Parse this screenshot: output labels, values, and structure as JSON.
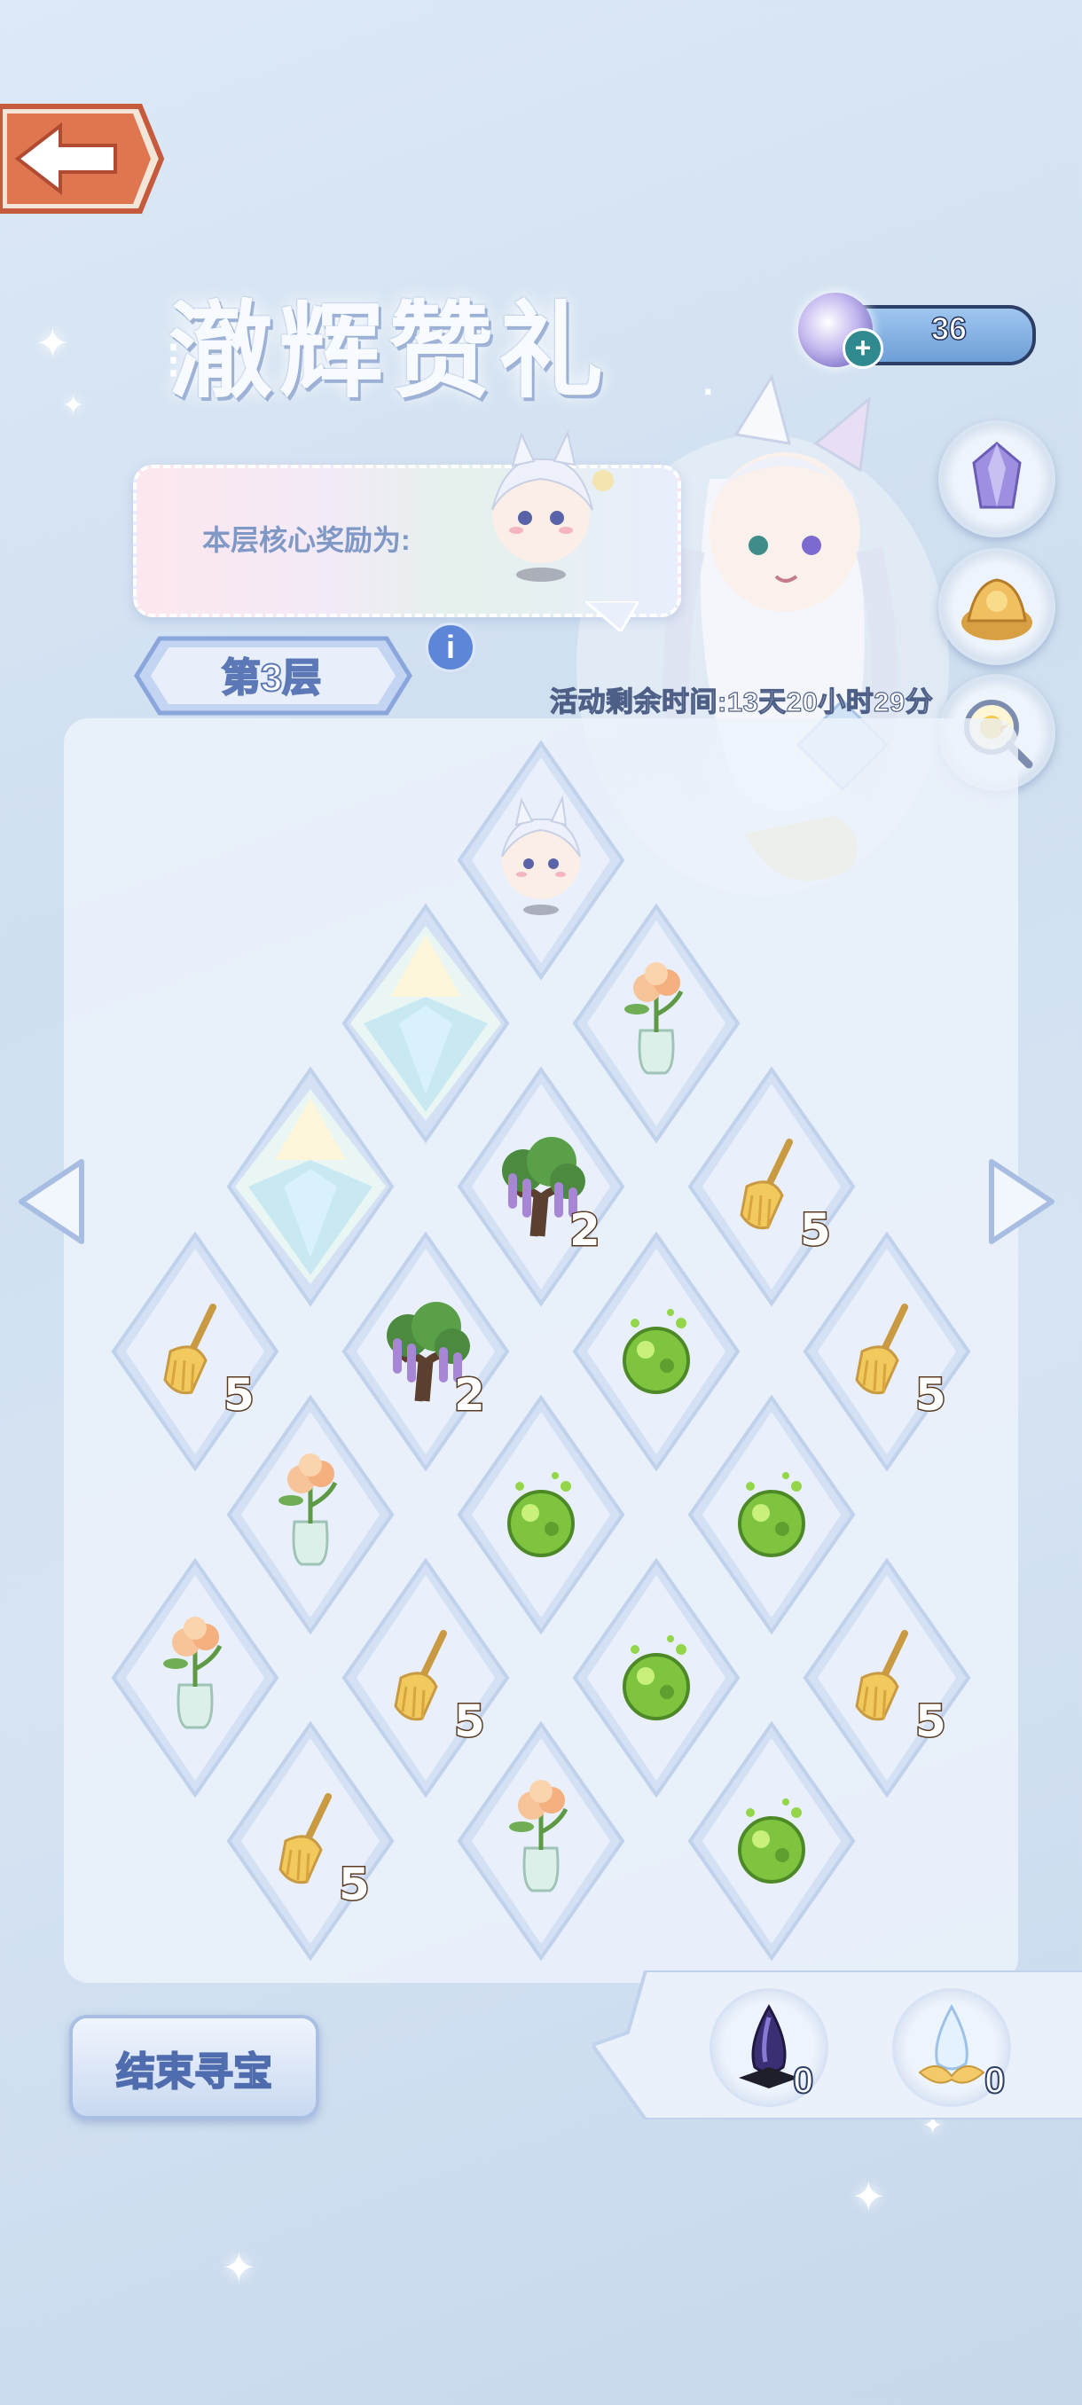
{
  "header": {
    "title": "澈辉赞礼",
    "currency": {
      "icon": "crystal-orb-icon",
      "value": "36"
    }
  },
  "reward": {
    "label": "本层核心奖励为:"
  },
  "floor": {
    "label": "第3层"
  },
  "timer": "活动剩余时间:13天20小时29分",
  "side_buttons": [
    {
      "name": "crystal-shard-icon"
    },
    {
      "name": "treasure-pile-icon"
    },
    {
      "name": "magnifier-duck-icon"
    }
  ],
  "board": {
    "tiles": [
      {
        "item": "pet",
        "count": ""
      },
      {
        "item": "crystal",
        "count": ""
      },
      {
        "item": "flower",
        "count": ""
      },
      {
        "item": "crystal",
        "count": ""
      },
      {
        "item": "tree",
        "count": "2"
      },
      {
        "item": "broom",
        "count": "5"
      },
      {
        "item": "broom",
        "count": "5"
      },
      {
        "item": "tree",
        "count": "2"
      },
      {
        "item": "orb",
        "count": ""
      },
      {
        "item": "broom",
        "count": "5"
      },
      {
        "item": "flower",
        "count": ""
      },
      {
        "item": "orb",
        "count": ""
      },
      {
        "item": "orb",
        "count": ""
      },
      {
        "item": "flower",
        "count": ""
      },
      {
        "item": "broom",
        "count": "5"
      },
      {
        "item": "orb",
        "count": ""
      },
      {
        "item": "broom",
        "count": "5"
      },
      {
        "item": "broom",
        "count": "5"
      },
      {
        "item": "flower",
        "count": ""
      },
      {
        "item": "orb",
        "count": ""
      }
    ]
  },
  "footer": {
    "end_button": "结束寻宝",
    "inventory": [
      {
        "icon": "dark-crystal-icon",
        "count": "0"
      },
      {
        "icon": "light-crystal-icon",
        "count": "0"
      }
    ]
  },
  "colors": {
    "accent": "#5c78b6",
    "board": "#edf3fb",
    "count_outline": "#5a3b22"
  }
}
